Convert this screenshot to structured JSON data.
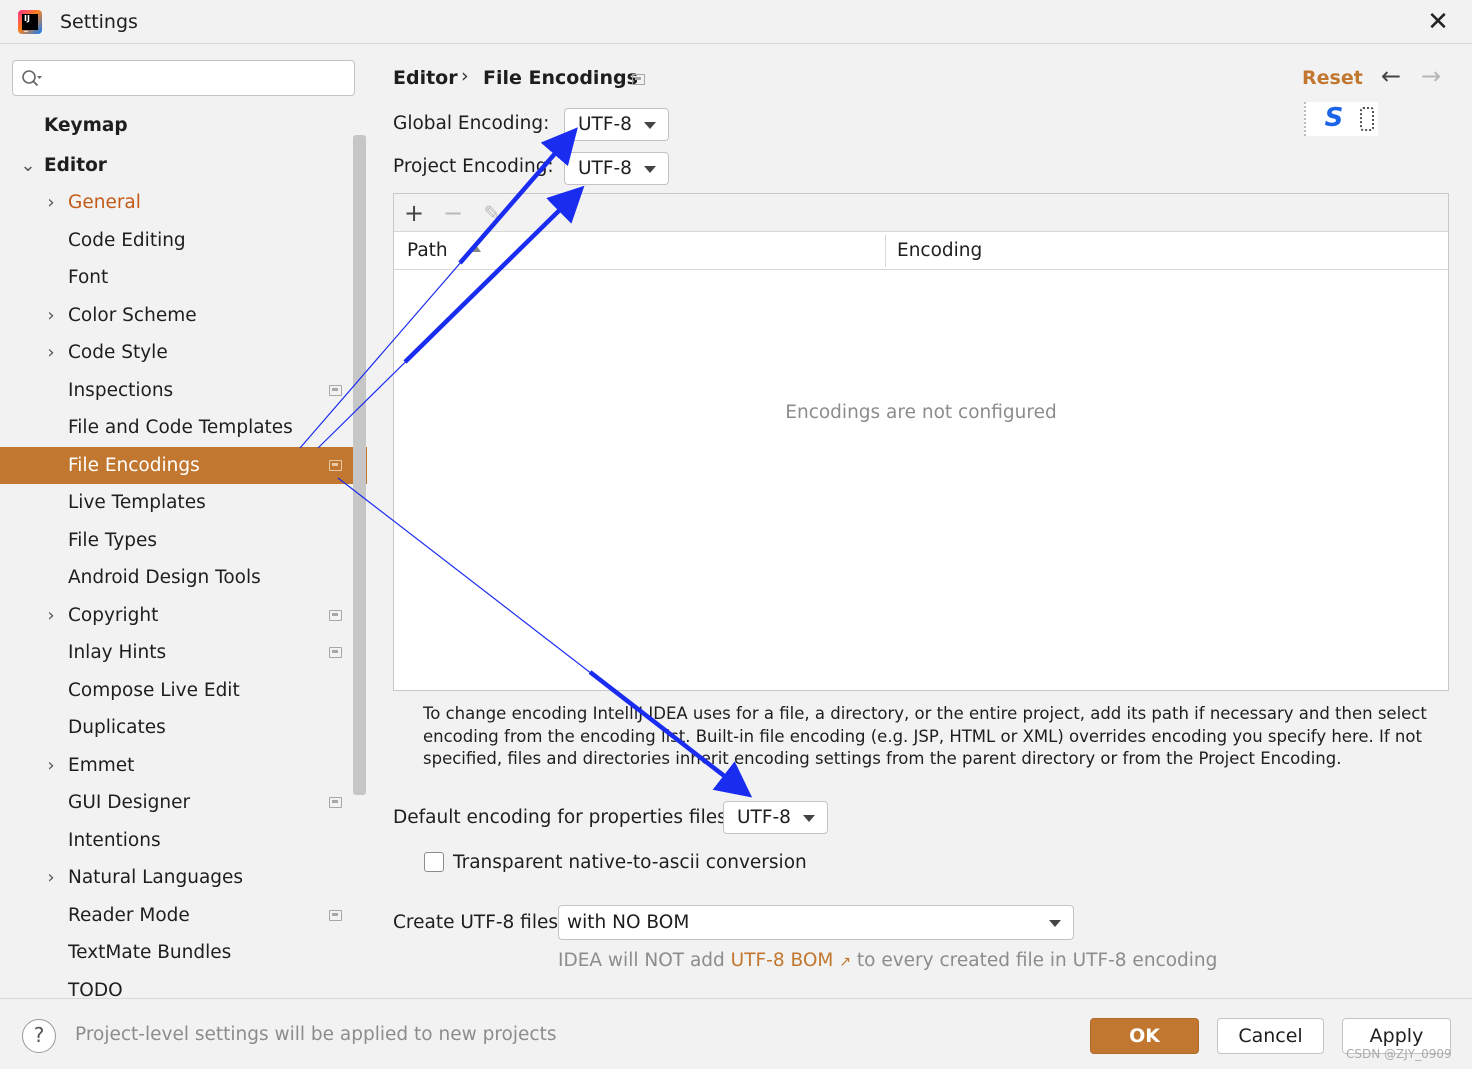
{
  "window": {
    "title": "Settings"
  },
  "sidebar": {
    "search_placeholder": "",
    "items": [
      {
        "label": "Keymap"
      },
      {
        "label": "Editor"
      },
      {
        "label": "General"
      },
      {
        "label": "Code Editing"
      },
      {
        "label": "Font"
      },
      {
        "label": "Color Scheme"
      },
      {
        "label": "Code Style"
      },
      {
        "label": "Inspections"
      },
      {
        "label": "File and Code Templates"
      },
      {
        "label": "File Encodings"
      },
      {
        "label": "Live Templates"
      },
      {
        "label": "File Types"
      },
      {
        "label": "Android Design Tools"
      },
      {
        "label": "Copyright"
      },
      {
        "label": "Inlay Hints"
      },
      {
        "label": "Compose Live Edit"
      },
      {
        "label": "Duplicates"
      },
      {
        "label": "Emmet"
      },
      {
        "label": "GUI Designer"
      },
      {
        "label": "Intentions"
      },
      {
        "label": "Natural Languages"
      },
      {
        "label": "Reader Mode"
      },
      {
        "label": "TextMate Bundles"
      },
      {
        "label": "TODO"
      }
    ]
  },
  "header": {
    "breadcrumb_parent": "Editor",
    "breadcrumb_current": "File Encodings",
    "reset_label": "Reset"
  },
  "form": {
    "global_encoding_label": "Global Encoding:",
    "global_encoding_value": "UTF-8",
    "project_encoding_label": "Project Encoding:",
    "project_encoding_value": "UTF-8",
    "table": {
      "columns": [
        "Path",
        "Encoding"
      ],
      "empty_text": "Encodings are not configured"
    },
    "help_text": "To change encoding IntelliJ IDEA uses for a file, a directory, or the entire project, add its path if necessary and then select encoding from the encoding list. Built-in file encoding (e.g. JSP, HTML or XML) overrides encoding you specify here. If not specified, files and directories inherit encoding settings from the parent directory or from the Project Encoding.",
    "properties_label": "Default encoding for properties files:",
    "properties_value": "UTF-8",
    "native_to_ascii_label": "Transparent native-to-ascii conversion",
    "native_to_ascii_checked": false,
    "create_utf8_label": "Create UTF-8 files:",
    "create_utf8_value": "with NO BOM",
    "bom_note_prefix": "IDEA will NOT add",
    "bom_note_link": "UTF-8 BOM",
    "bom_note_suffix": "to every created file in UTF-8 encoding"
  },
  "footer": {
    "note": "Project-level settings will be applied to new projects",
    "ok_label": "OK",
    "cancel_label": "Cancel",
    "apply_label": "Apply",
    "help_glyph": "?"
  },
  "watermark": "CSDN @ZJY_0909",
  "colors": {
    "accent": "#c1772f",
    "selected_bg": "#c1772f",
    "general_text": "#c45a17",
    "annotation_arrow": "#1a2cf0"
  },
  "icons": {
    "app": "intellij-idea-icon",
    "close": "close-icon",
    "search": "search-icon",
    "back": "arrow-left-icon",
    "forward": "arrow-right-icon",
    "add": "plus-icon",
    "remove": "minus-icon",
    "edit": "pencil-icon",
    "project": "project-scope-icon",
    "external_link": "external-link-icon"
  }
}
